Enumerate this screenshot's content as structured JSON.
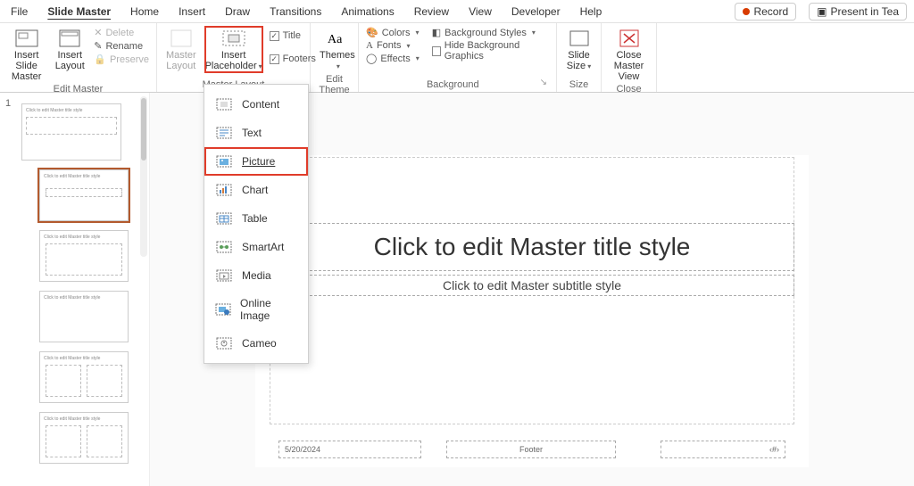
{
  "menubar": {
    "tabs": [
      "File",
      "Slide Master",
      "Home",
      "Insert",
      "Draw",
      "Transitions",
      "Animations",
      "Review",
      "View",
      "Developer",
      "Help"
    ],
    "active_index": 1,
    "record": "Record",
    "present": "Present in Tea"
  },
  "ribbon": {
    "edit_master": {
      "insert_slide_master": "Insert Slide\nMaster",
      "insert_layout": "Insert\nLayout",
      "delete": "Delete",
      "rename": "Rename",
      "preserve": "Preserve",
      "group_label": "Edit Master"
    },
    "master_layout": {
      "master_layout": "Master\nLayout",
      "insert_placeholder": "Insert\nPlaceholder",
      "title_chk": "Title",
      "footers_chk": "Footers",
      "group_label": "Master Layout"
    },
    "edit_theme": {
      "themes": "Themes",
      "group_label": "Edit Theme"
    },
    "background": {
      "colors": "Colors",
      "fonts": "Fonts",
      "effects": "Effects",
      "bg_styles": "Background Styles",
      "hide_bg": "Hide Background Graphics",
      "group_label": "Background"
    },
    "size": {
      "slide_size": "Slide\nSize",
      "group_label": "Size"
    },
    "close": {
      "close_master": "Close\nMaster View",
      "group_label": "Close"
    }
  },
  "placeholder_menu": {
    "items": [
      "Content",
      "Text",
      "Picture",
      "Chart",
      "Table",
      "SmartArt",
      "Media",
      "Online Image",
      "Cameo"
    ],
    "highlighted_index": 2
  },
  "thumbs": {
    "number": "1",
    "thumb_text": "Click to edit Master title style"
  },
  "slide": {
    "title": "Click to edit Master title style",
    "subtitle": "Click to edit Master subtitle style",
    "date": "5/20/2024",
    "footer": "Footer",
    "num": "‹#›"
  }
}
